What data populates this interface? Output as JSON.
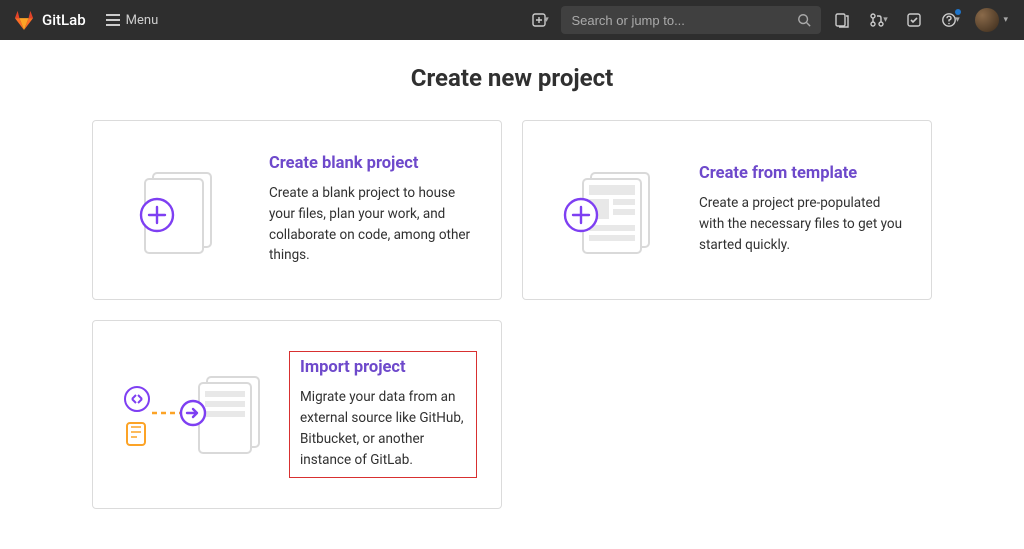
{
  "navbar": {
    "brand": "GitLab",
    "menu_label": "Menu",
    "search_placeholder": "Search or jump to..."
  },
  "page": {
    "title": "Create new project"
  },
  "cards": {
    "blank": {
      "title": "Create blank project",
      "desc": "Create a blank project to house your files, plan your work, and collaborate on code, among other things."
    },
    "template": {
      "title": "Create from template",
      "desc": "Create a project pre-populated with the necessary files to get you started quickly."
    },
    "import": {
      "title": "Import project",
      "desc": "Migrate your data from an external source like GitHub, Bitbucket, or another instance of GitLab."
    }
  },
  "colors": {
    "accent": "#6e49cb"
  }
}
